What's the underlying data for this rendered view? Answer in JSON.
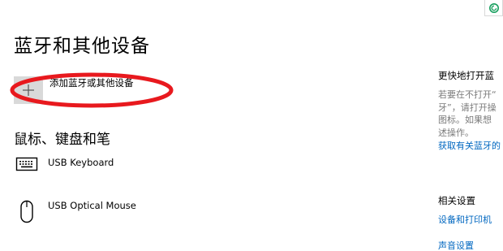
{
  "page": {
    "title": "蓝牙和其他设备"
  },
  "add_device": {
    "label": "添加蓝牙或其他设备",
    "icon": "plus-icon"
  },
  "section": {
    "heading": "鼠标、键盘和笔"
  },
  "devices": [
    {
      "name": "USB Keyboard",
      "icon": "keyboard-icon"
    },
    {
      "name": "USB Optical Mouse",
      "icon": "mouse-icon"
    }
  ],
  "right_panel": {
    "heading": "更快地打开蓝",
    "description": "若要在不打开“\n牙”，请打开操\n图标。如果想\n述操作。",
    "link": "获取有关蓝牙的",
    "related_heading": "相关设置",
    "related_links": [
      "设备和打印机",
      "声音设置"
    ]
  },
  "colors": {
    "accent_link": "#0067c0",
    "annotation_red": "#e8191e",
    "add_tile_bg": "#d9d9d9",
    "muted_text": "#7a7a7a",
    "badge_icon": "#1aa060"
  }
}
